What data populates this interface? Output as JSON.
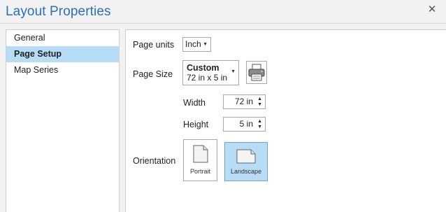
{
  "window": {
    "title": "Layout Properties",
    "close_glyph": "✕"
  },
  "sidebar": {
    "items": [
      {
        "label": "General",
        "selected": false
      },
      {
        "label": "Page Setup",
        "selected": true
      },
      {
        "label": "Map Series",
        "selected": false
      }
    ]
  },
  "page_setup": {
    "page_units_label": "Page units",
    "page_units_value": "Inch",
    "page_size_label": "Page Size",
    "page_size_name": "Custom",
    "page_size_dims": "72 in x 5 in",
    "printer_icon": "printer-icon",
    "width_label": "Width",
    "width_value": "72 in",
    "height_label": "Height",
    "height_value": "5 in",
    "orientation_label": "Orientation",
    "orientation_options": [
      {
        "label": "Portrait",
        "selected": false
      },
      {
        "label": "Landscape",
        "selected": true
      }
    ]
  },
  "colors": {
    "title": "#2b6fbd",
    "selection": "#b7dcf6"
  }
}
